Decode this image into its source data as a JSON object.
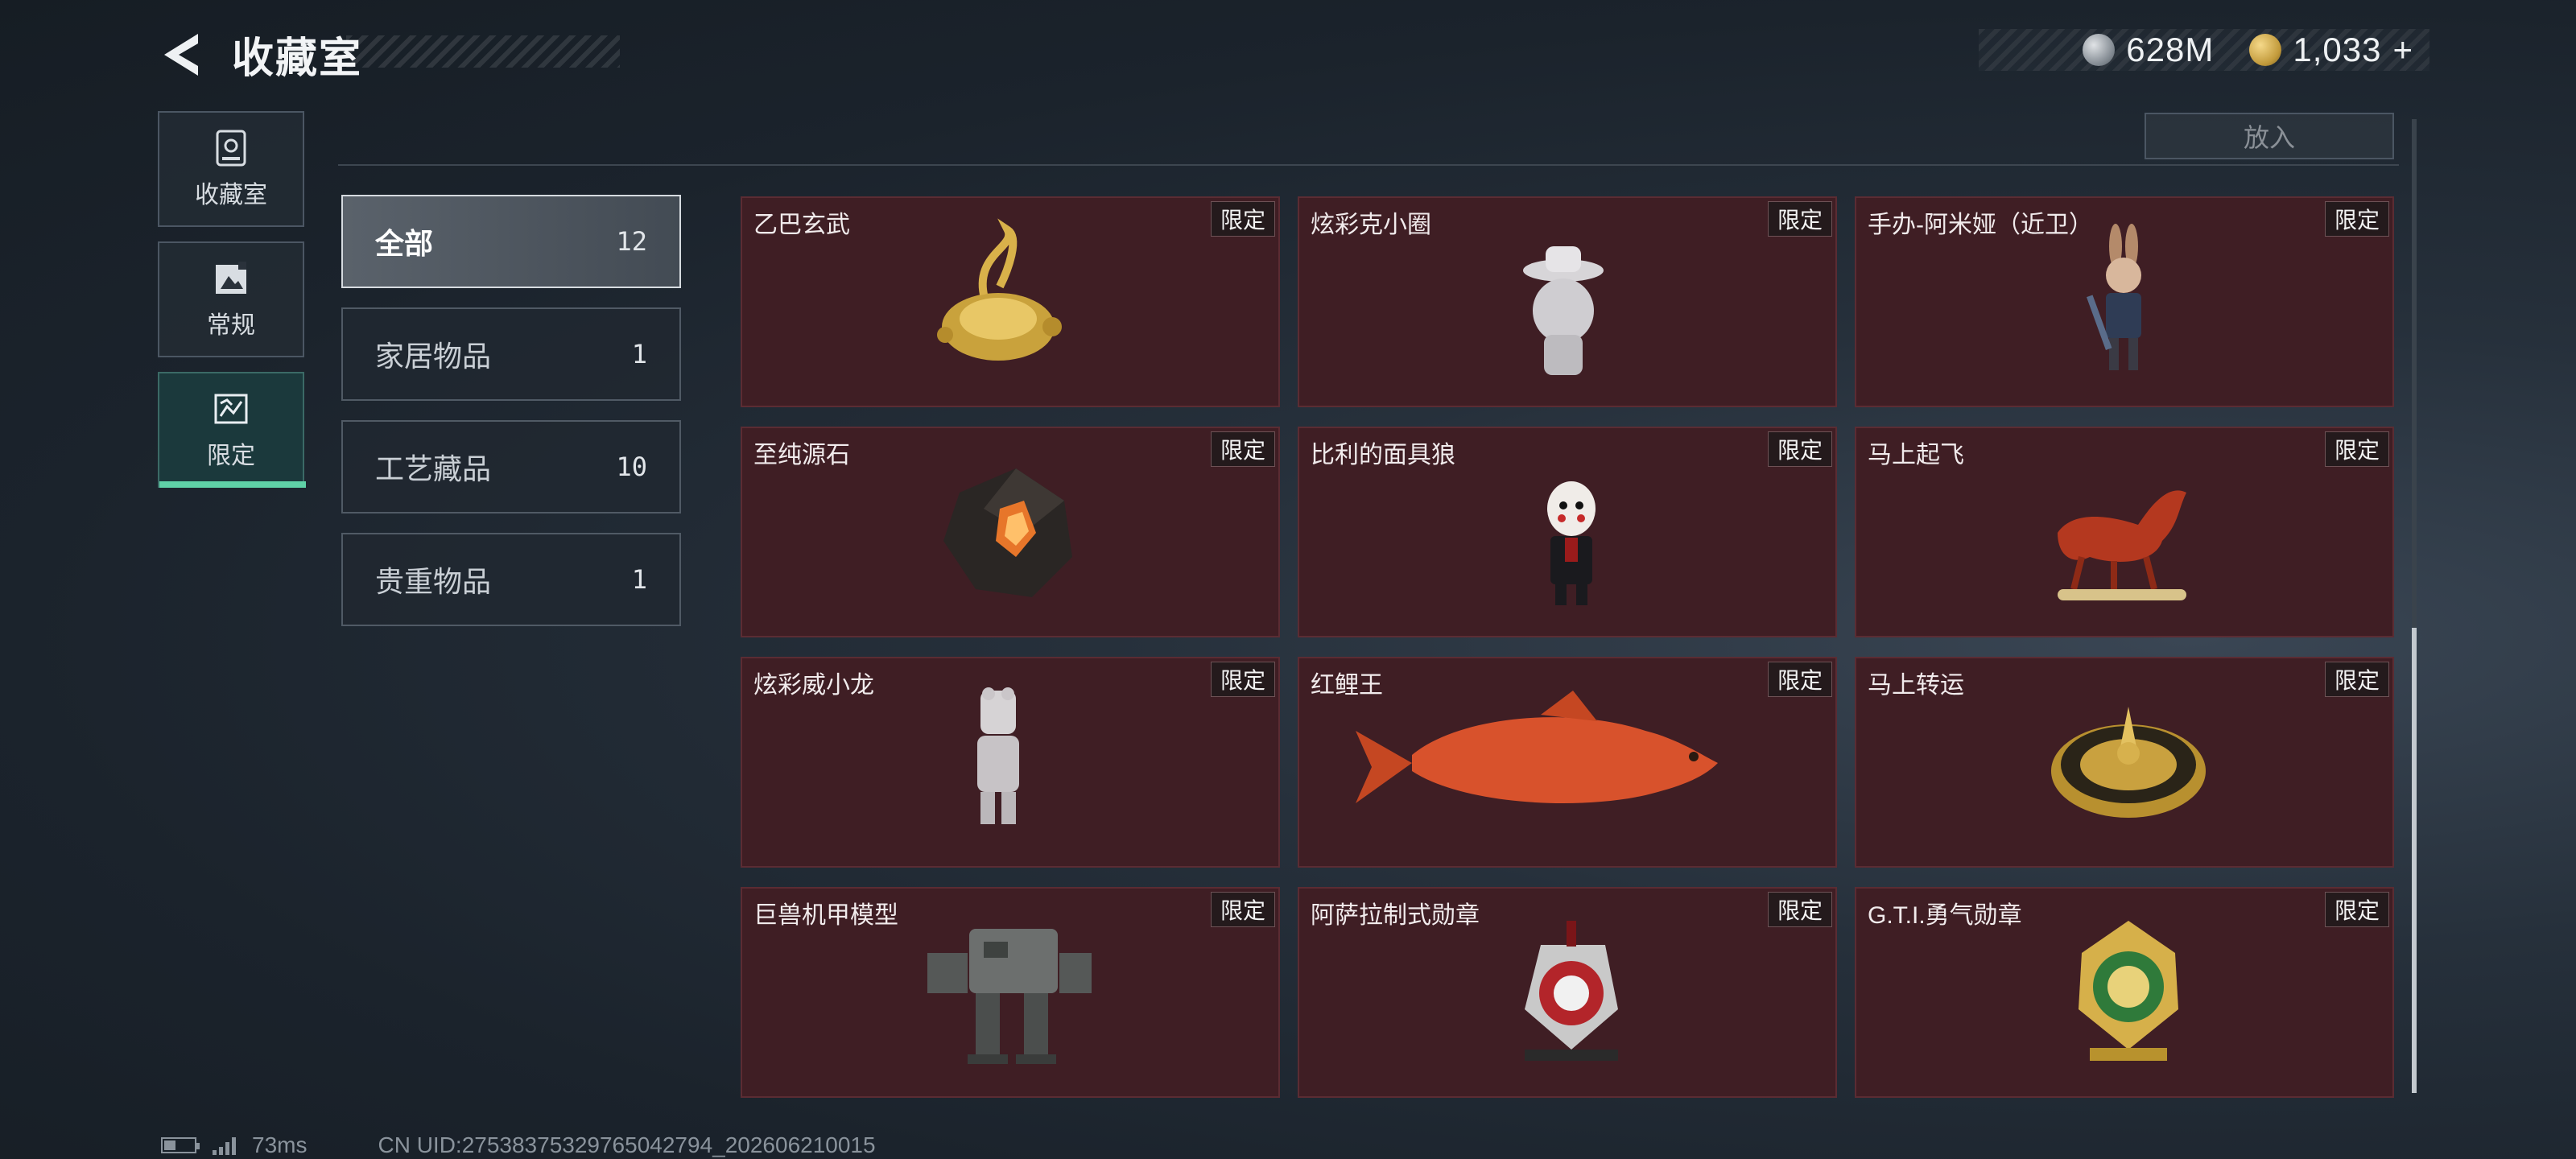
{
  "header": {
    "title": "收藏室",
    "currency": [
      {
        "icon": "silver-coin-icon",
        "value": "628M"
      },
      {
        "icon": "gold-coin-icon",
        "value": "1,033"
      }
    ],
    "add_symbol": "+"
  },
  "rail": [
    {
      "label": "收藏室",
      "icon": "collection-room-icon"
    },
    {
      "label": "常规",
      "icon": "regular-frame-icon"
    },
    {
      "label": "限定",
      "icon": "limited-frame-icon",
      "active": true
    }
  ],
  "put_in_label": "放入",
  "categories": [
    {
      "name": "全部",
      "count": "12",
      "active": true
    },
    {
      "name": "家居物品",
      "count": "1"
    },
    {
      "name": "工艺藏品",
      "count": "10"
    },
    {
      "name": "贵重物品",
      "count": "1"
    }
  ],
  "items": [
    {
      "name": "乙巴玄武",
      "tag": "限定",
      "icon": "gold-turtle-snake-icon"
    },
    {
      "name": "炫彩克小圈",
      "tag": "限定",
      "icon": "silver-figurine-hat-icon"
    },
    {
      "name": "手办-阿米娅（近卫）",
      "tag": "限定",
      "icon": "anime-figure-icon"
    },
    {
      "name": "至纯源石",
      "tag": "限定",
      "icon": "dark-crystal-icon"
    },
    {
      "name": "比利的面具狼",
      "tag": "限定",
      "icon": "puppet-figure-icon"
    },
    {
      "name": "马上起飞",
      "tag": "限定",
      "icon": "red-horse-icon"
    },
    {
      "name": "炫彩威小龙",
      "tag": "限定",
      "icon": "silver-dragon-figure-icon"
    },
    {
      "name": "红鲤王",
      "tag": "限定",
      "icon": "red-carp-icon"
    },
    {
      "name": "马上转运",
      "tag": "限定",
      "icon": "gold-compass-icon"
    },
    {
      "name": "巨兽机甲模型",
      "tag": "限定",
      "icon": "mech-model-icon"
    },
    {
      "name": "阿萨拉制式勋章",
      "tag": "限定",
      "icon": "red-medal-icon"
    },
    {
      "name": "G.T.I.勇气勋章",
      "tag": "限定",
      "icon": "gold-medal-icon"
    }
  ],
  "footer": {
    "ping": "73ms",
    "uid": "CN UID:27538375329765042794_202606210015"
  }
}
